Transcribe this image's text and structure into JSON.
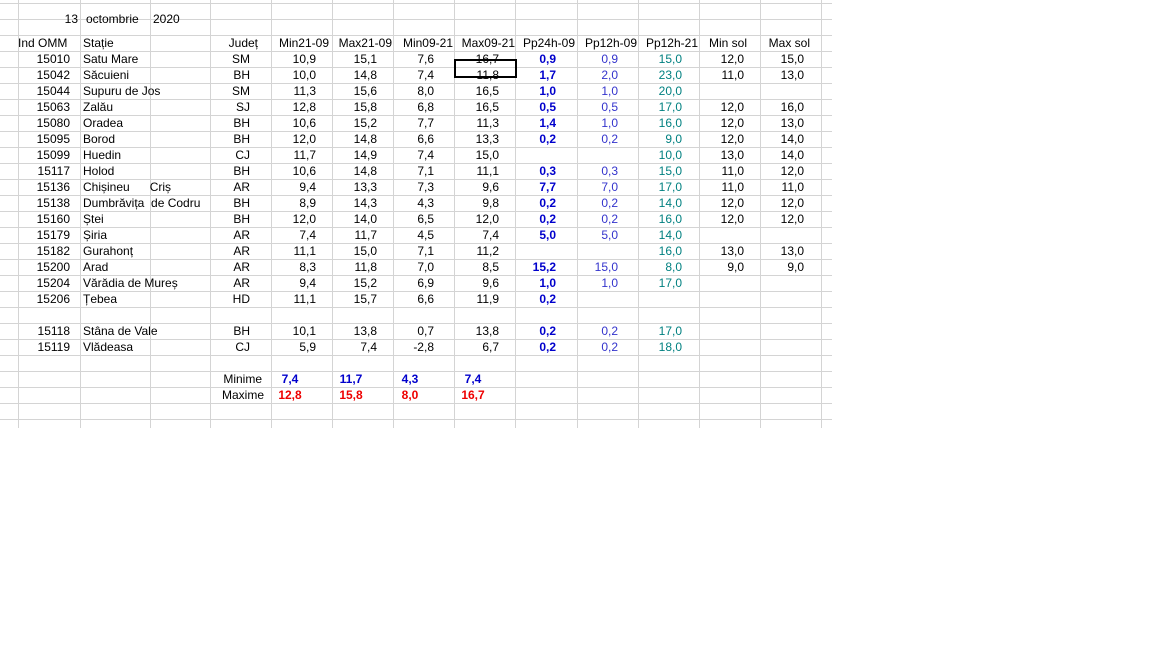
{
  "date": {
    "day": "13",
    "month": "octombrie",
    "year": "2020"
  },
  "headers": [
    "Ind OMM",
    "Stație",
    "Județ",
    "Min21-09",
    "Max21-09",
    "Min09-21",
    "Max09-21",
    "Pp24h-09",
    "Pp12h-09",
    "Pp12h-21",
    "Min sol",
    "Max sol"
  ],
  "rows": [
    [
      "15010",
      "Satu Mare",
      "SM",
      "10,9",
      "15,1",
      "7,6",
      "16,7",
      "0,9",
      "0,9",
      "15,0",
      "12,0",
      "15,0"
    ],
    [
      "15042",
      "Săcuieni",
      "BH",
      "10,0",
      "14,8",
      "7,4",
      "11,8",
      "1,7",
      "2,0",
      "23,0",
      "11,0",
      "13,0"
    ],
    [
      "15044",
      "Supuru de Jos",
      "SM",
      "11,3",
      "15,6",
      "8,0",
      "16,5",
      "1,0",
      "1,0",
      "20,0",
      "",
      ""
    ],
    [
      "15063",
      "Zalău",
      "SJ",
      "12,8",
      "15,8",
      "6,8",
      "16,5",
      "0,5",
      "0,5",
      "17,0",
      "12,0",
      "16,0"
    ],
    [
      "15080",
      "Oradea",
      "BH",
      "10,6",
      "15,2",
      "7,7",
      "11,3",
      "1,4",
      "1,0",
      "16,0",
      "12,0",
      "13,0"
    ],
    [
      "15095",
      "Borod",
      "BH",
      "12,0",
      "14,8",
      "6,6",
      "13,3",
      "0,2",
      "0,2",
      "9,0",
      "12,0",
      "14,0"
    ],
    [
      "15099",
      "Huedin",
      "CJ",
      "11,7",
      "14,9",
      "7,4",
      "15,0",
      "",
      "",
      "10,0",
      "13,0",
      "14,0"
    ],
    [
      "15117",
      "Holod",
      "BH",
      "10,6",
      "14,8",
      "7,1",
      "11,1",
      "0,3",
      "0,3",
      "15,0",
      "11,0",
      "12,0"
    ],
    [
      "15136",
      "Chișineu      Criș",
      "AR",
      "9,4",
      "13,3",
      "7,3",
      "9,6",
      "7,7",
      "7,0",
      "17,0",
      "11,0",
      "11,0"
    ],
    [
      "15138",
      "Dumbrăvița  de Codru",
      "BH",
      "8,9",
      "14,3",
      "4,3",
      "9,8",
      "0,2",
      "0,2",
      "14,0",
      "12,0",
      "12,0"
    ],
    [
      "15160",
      "Ștei",
      "BH",
      "12,0",
      "14,0",
      "6,5",
      "12,0",
      "0,2",
      "0,2",
      "16,0",
      "12,0",
      "12,0"
    ],
    [
      "15179",
      "Șiria",
      "AR",
      "7,4",
      "11,7",
      "4,5",
      "7,4",
      "5,0",
      "5,0",
      "14,0",
      "",
      ""
    ],
    [
      "15182",
      "Gurahonț",
      "AR",
      "11,1",
      "15,0",
      "7,1",
      "11,2",
      "",
      "",
      "16,0",
      "13,0",
      "13,0"
    ],
    [
      "15200",
      "Arad",
      "AR",
      "8,3",
      "11,8",
      "7,0",
      "8,5",
      "15,2",
      "15,0",
      "8,0",
      "9,0",
      "9,0"
    ],
    [
      "15204",
      "Vărădia de Mureș",
      "AR",
      "9,4",
      "15,2",
      "6,9",
      "9,6",
      "1,0",
      "1,0",
      "17,0",
      "",
      ""
    ],
    [
      "15206",
      "Țebea",
      "HD",
      "11,1",
      "15,7",
      "6,6",
      "11,9",
      "0,2",
      "",
      "",
      "",
      ""
    ]
  ],
  "mountain_rows": [
    [
      "15118",
      "Stâna de Vale",
      "BH",
      "10,1",
      "13,8",
      "0,7",
      "13,8",
      "0,2",
      "0,2",
      "17,0",
      "",
      ""
    ],
    [
      "15119",
      "Vlădeasa",
      "CJ",
      "5,9",
      "7,4",
      "-2,8",
      "6,7",
      "0,2",
      "0,2",
      "18,0",
      "",
      ""
    ]
  ],
  "summary": {
    "min_label": "Minime",
    "max_label": "Maxime",
    "min_values": [
      "7,4",
      "11,7",
      "4,3",
      "7,4"
    ],
    "max_values": [
      "12,8",
      "15,8",
      "8,0",
      "16,7"
    ]
  },
  "colors": {
    "bold_blue": "#0000cc",
    "purple_blue": "#3333cc",
    "teal": "#008080",
    "red": "#ee0000",
    "grid": "#d4d4d4"
  }
}
